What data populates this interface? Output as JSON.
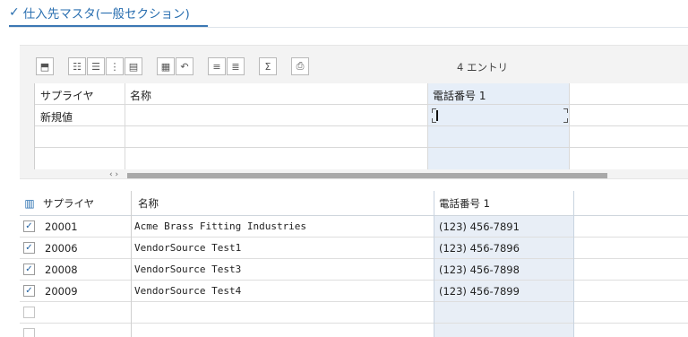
{
  "section": {
    "check_icon": "check-icon",
    "title": "仕入先マスタ(一般セクション)"
  },
  "toolbar": {
    "entries_label": "4 エントリ",
    "buttons": [
      {
        "name": "insert-row-icon",
        "glyph": "⬒"
      },
      {
        "name": "list-numbered-icon",
        "glyph": "☷"
      },
      {
        "name": "list-bulleted-icon",
        "glyph": "☰"
      },
      {
        "name": "list-indent-icon",
        "glyph": "⋮"
      },
      {
        "name": "details-icon",
        "glyph": "▤"
      },
      {
        "name": "column-settings-icon",
        "glyph": "▦"
      },
      {
        "name": "undo-icon",
        "glyph": "↶"
      },
      {
        "name": "align-center-icon",
        "glyph": "≡"
      },
      {
        "name": "filter-icon",
        "glyph": "≣"
      },
      {
        "name": "sum-icon",
        "glyph": "Σ"
      },
      {
        "name": "print-icon",
        "glyph": "⎙"
      }
    ]
  },
  "entry_grid": {
    "headers": [
      "サプライヤ",
      "名称",
      "電話番号 1"
    ],
    "new_value_label": "新規値",
    "scroll_arrows": "‹ ›"
  },
  "table": {
    "column_settings_icon": "column-chooser-icon",
    "headers": [
      "サプライヤ",
      "名称",
      "電話番号 1"
    ],
    "rows": [
      {
        "checked": true,
        "supplier": "20001",
        "name": "Acme Brass Fitting Industries",
        "phone": "(123) 456-7891"
      },
      {
        "checked": true,
        "supplier": "20006",
        "name": "VendorSource Test1",
        "phone": "(123) 456-7896"
      },
      {
        "checked": true,
        "supplier": "20008",
        "name": "VendorSource Test3",
        "phone": "(123) 456-7898"
      },
      {
        "checked": true,
        "supplier": "20009",
        "name": "VendorSource Test4",
        "phone": "(123) 456-7899"
      },
      {
        "checked": false,
        "supplier": "",
        "name": "",
        "phone": ""
      },
      {
        "checked": false,
        "supplier": "",
        "name": "",
        "phone": ""
      }
    ]
  },
  "colors": {
    "accent": "#2a6fb0",
    "selected_column": "#e8eef6",
    "panel_bg": "#f3f3f3"
  }
}
